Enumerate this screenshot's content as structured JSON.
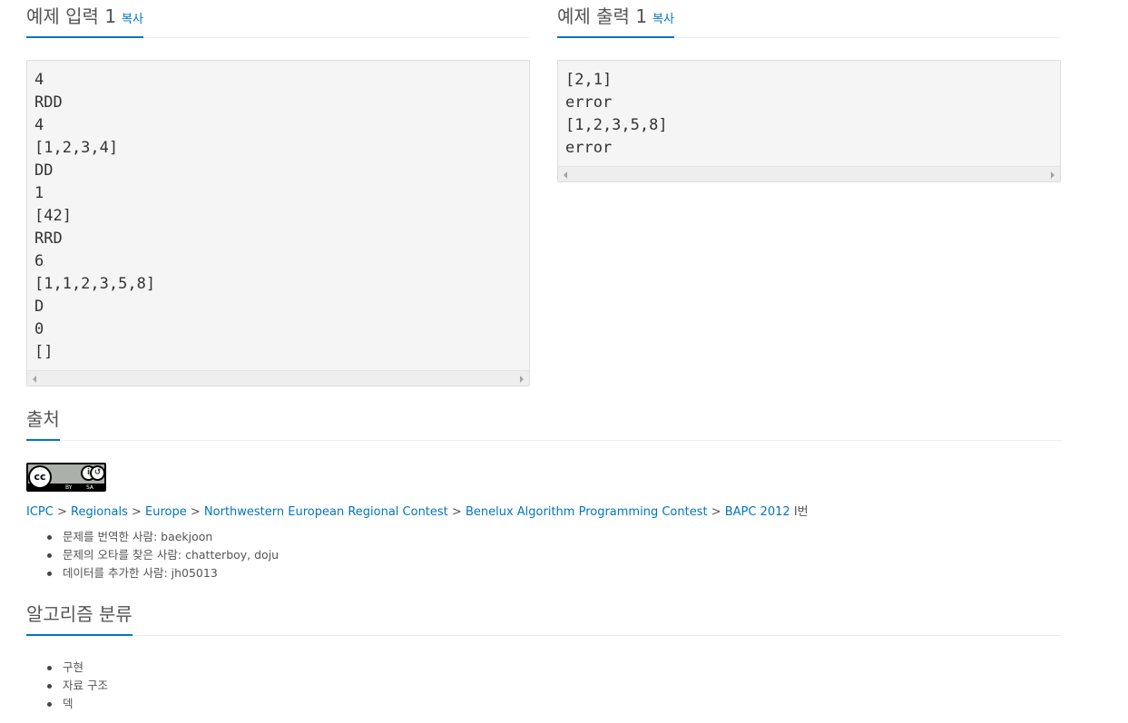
{
  "sample_input": {
    "title": "예제 입력 1",
    "copy_label": "복사",
    "lines": [
      "4",
      "RDD",
      "4",
      "[1,2,3,4]",
      "DD",
      "1",
      "[42]",
      "RRD",
      "6",
      "[1,1,2,3,5,8]",
      "D",
      "0",
      "[]"
    ]
  },
  "sample_output": {
    "title": "예제 출력 1",
    "copy_label": "복사",
    "lines": [
      "[2,1]",
      "error",
      "[1,2,3,5,8]",
      "error"
    ]
  },
  "source": {
    "title": "출처",
    "license_badge": {
      "main": "cc",
      "by": "BY",
      "sa": "SA"
    },
    "breadcrumb": [
      "ICPC",
      "Regionals",
      "Europe",
      "Northwestern European Regional Contest",
      "Benelux Algorithm Programming Contest",
      "BAPC 2012"
    ],
    "separator": ">",
    "suffix": "I번",
    "credits": [
      "문제를 번역한 사람: baekjoon",
      "문제의 오타를 찾은 사람: chatterboy, doju",
      "데이터를 추가한 사람: jh05013"
    ]
  },
  "algorithm": {
    "title": "알고리즘 분류",
    "tags": [
      "구현",
      "자료 구조",
      "덱"
    ]
  },
  "colors": {
    "link": "#0076c0",
    "accent_underline": "#0076c0",
    "pre_bg": "#f5f5f5"
  }
}
